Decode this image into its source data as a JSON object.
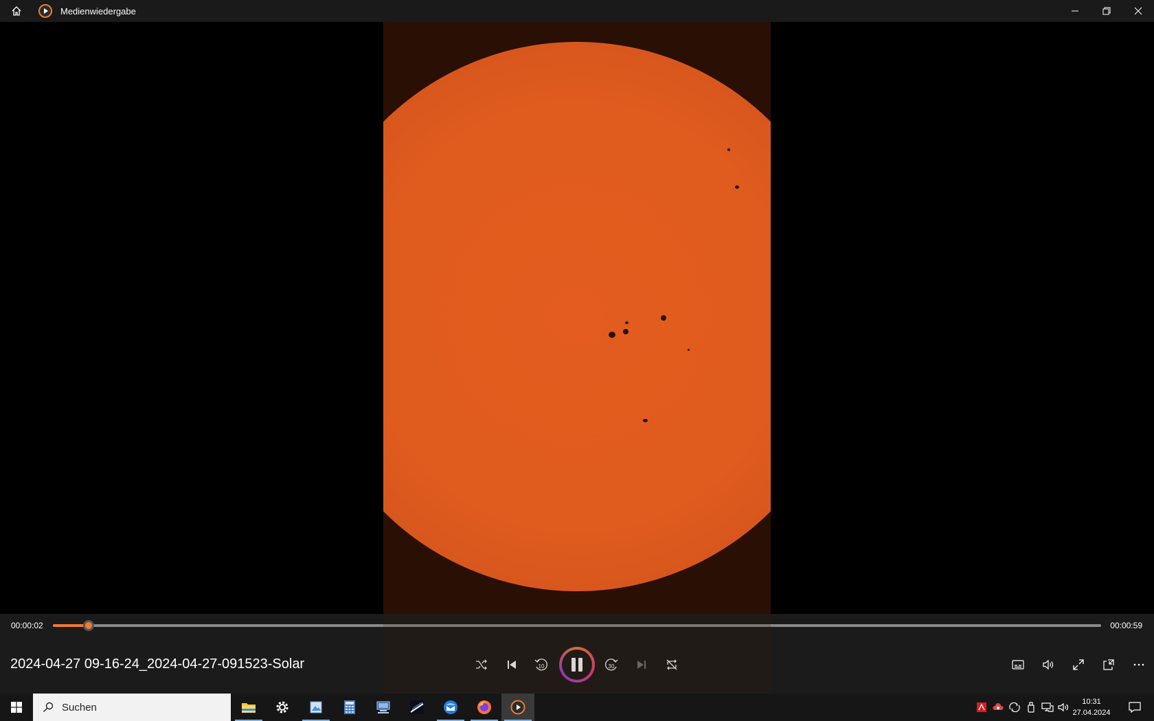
{
  "window": {
    "title": "Medienwiedergabe",
    "controls": [
      "minimize",
      "restore",
      "close"
    ]
  },
  "player": {
    "current_time": "00:00:02",
    "duration": "00:00:59",
    "progress": 0.0339,
    "media_title": "2024-04-27 09-16-24_2024-04-27-091523-Solar",
    "accent_color": "#f27b2f",
    "buttons": {
      "center": [
        "shuffle-icon",
        "previous-icon",
        "rewind-10-icon",
        "pause-icon",
        "forward-30-icon",
        "next-icon",
        "repeat-icon"
      ],
      "right": [
        "subtitles-icon",
        "volume-icon",
        "fullscreen-icon",
        "miniplayer-icon",
        "more-icon"
      ]
    },
    "rewind_label": "10",
    "forward_label": "30"
  },
  "taskbar": {
    "search_placeholder": "Suchen",
    "apps": [
      "file-explorer-icon",
      "settings-icon",
      "paint-icon",
      "calculator-icon",
      "network-app-icon",
      "stellarium-icon",
      "thunderbird-icon",
      "firefox-icon",
      "media-player-icon"
    ],
    "clock_time": "10:31",
    "clock_date": "27.04.2024"
  }
}
